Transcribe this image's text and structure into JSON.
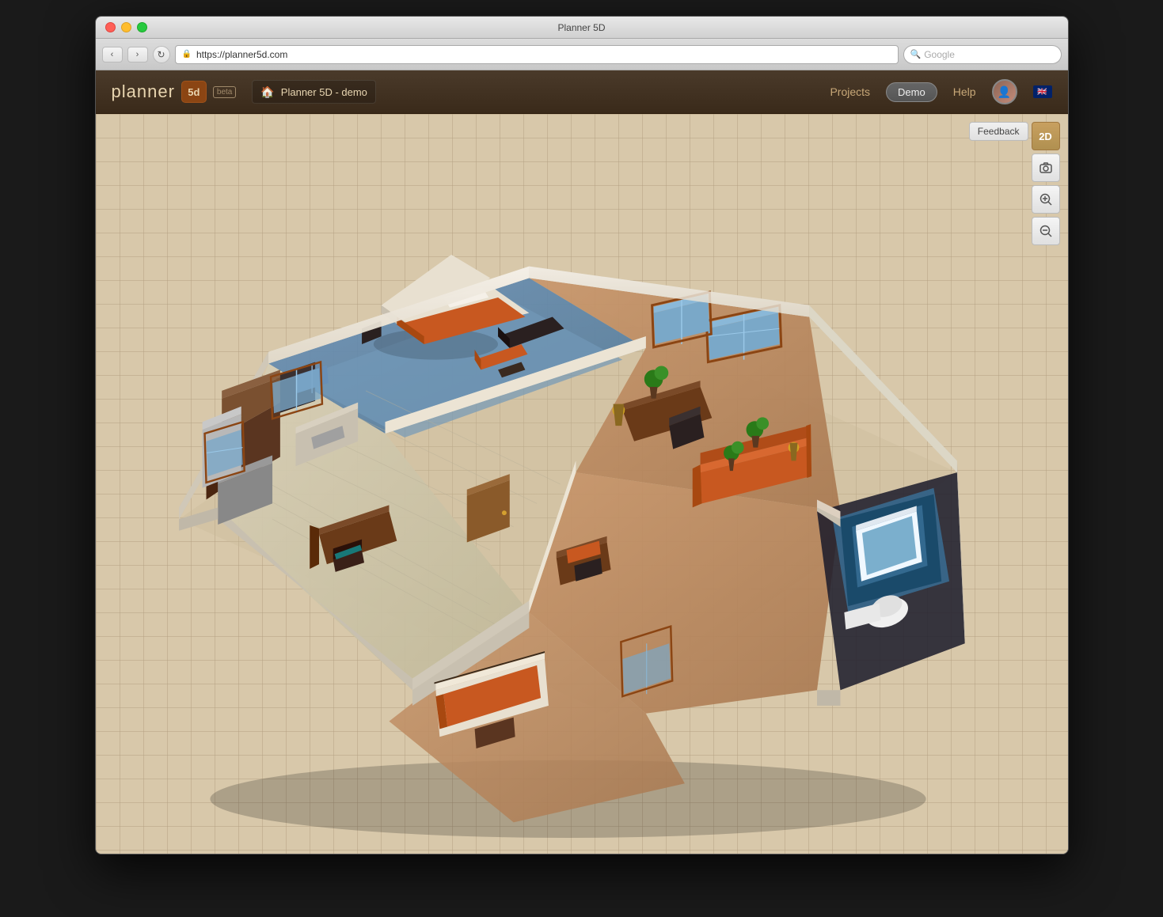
{
  "window": {
    "title": "Planner 5D",
    "url": "https://planner5d.com",
    "search_placeholder": "Google"
  },
  "header": {
    "logo_text": "planner",
    "logo_5d": "5d",
    "beta_label": "beta",
    "project_name": "Planner 5D - demo",
    "nav": {
      "projects": "Projects",
      "demo": "Demo",
      "help": "Help"
    }
  },
  "toolbar": {
    "feedback_label": "Feedback",
    "view_2d": "2D",
    "screenshot_icon": "📷",
    "zoom_in_icon": "🔍+",
    "zoom_out_icon": "🔍-"
  },
  "colors": {
    "header_bg": "#3a2a1a",
    "canvas_bg": "#d8c8aa",
    "accent": "#8B4513",
    "wall_color": "#f5f0e8",
    "floor_wood": "#b8906a",
    "floor_tile": "#d0c8b0",
    "floor_blue": "#8ab0d0",
    "furniture_orange": "#c8601a",
    "furniture_dark": "#3a2a1a"
  }
}
